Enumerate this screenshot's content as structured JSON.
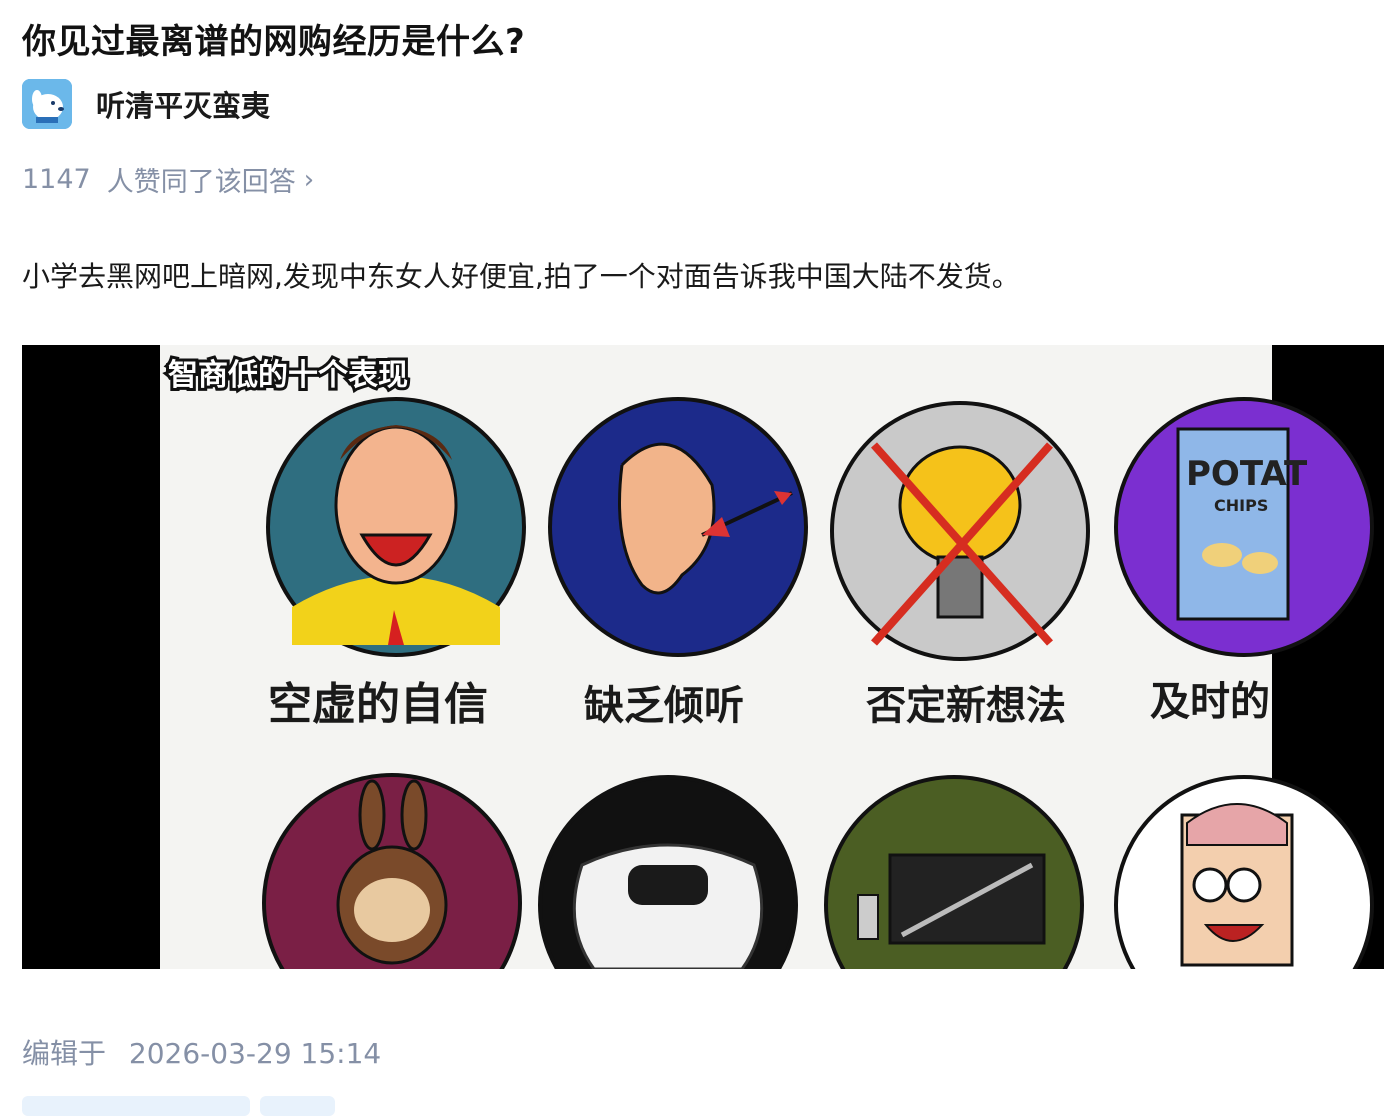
{
  "question": {
    "title": "你见过最离谱的网购经历是什么?"
  },
  "author": {
    "name": "听清平灭蛮夷",
    "avatar_icon": "dog-avatar-icon"
  },
  "answer": {
    "vote_count": "1147",
    "vote_text": "人赞同了该回答",
    "vote_chevron": "›",
    "content": "小学去黑网吧上暗网,发现中东女人好便宜,拍了一个对面告诉我中国大陆不发货。",
    "edited_label": "编辑于",
    "edited_time": "2026-03-29  15:14"
  },
  "image": {
    "heading": "智商低的十个表现",
    "row1": [
      {
        "label": "空虚的自信",
        "icon": "smiling-man-icon",
        "bg": "#2f6e80"
      },
      {
        "label": "缺乏倾听",
        "icon": "ear-arrow-icon",
        "bg": "#1c2a8a"
      },
      {
        "label": "否定新想法",
        "icon": "crossed-lightbulb-icon",
        "bg": "#c9c9c9"
      },
      {
        "label": "及时的",
        "icon": "potato-chips-icon",
        "bg": "#7b2fd0"
      }
    ],
    "row2": [
      {
        "icon": "labubu-toy-icon",
        "bg": "#7a1f45"
      },
      {
        "icon": "game-controller-icon",
        "bg": "#111111"
      },
      {
        "icon": "tablet-icon",
        "bg": "#4b5e23"
      },
      {
        "icon": "cartoon-brain-man-icon",
        "bg": "#ffffff"
      }
    ],
    "chips_text": "POTAT",
    "chips_sub": "CHIPS"
  }
}
